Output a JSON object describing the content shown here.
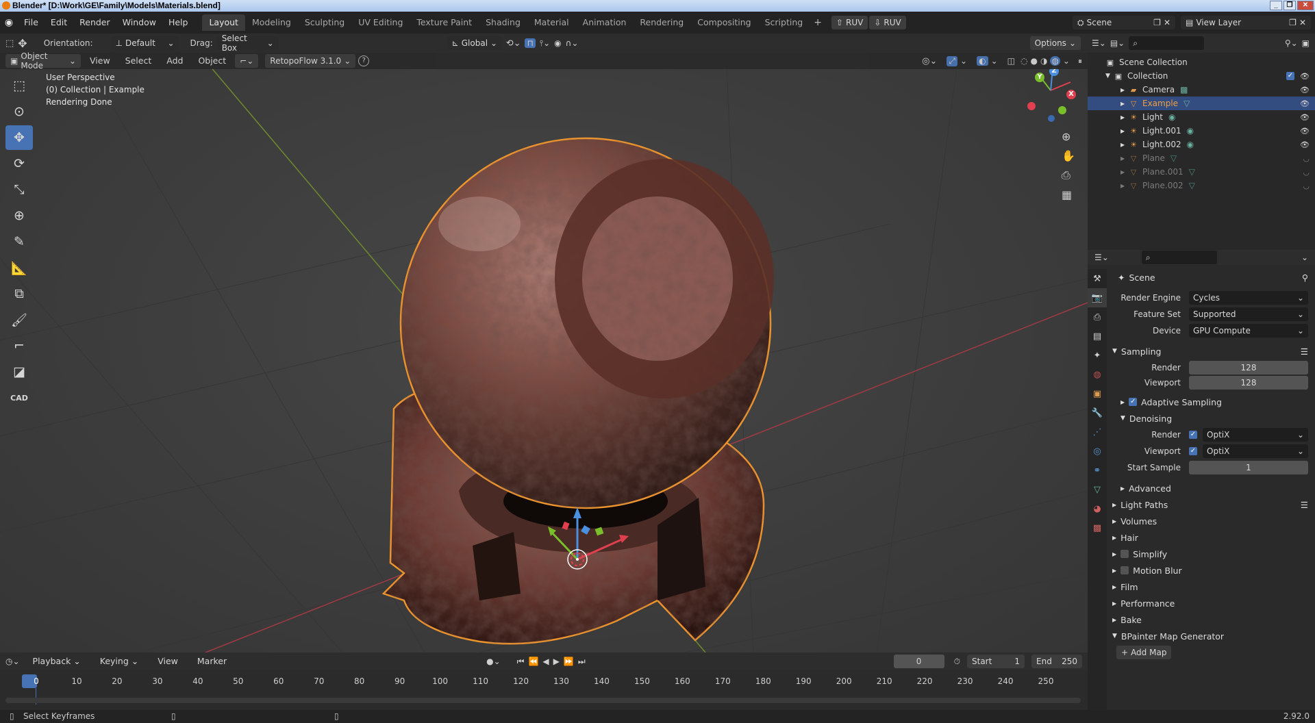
{
  "window": {
    "title": "Blender* [D:\\Work\\GE\\Family\\Models\\Materials.blend]"
  },
  "menu": [
    "File",
    "Edit",
    "Render",
    "Window",
    "Help"
  ],
  "workspaces": [
    "Layout",
    "Modeling",
    "Sculpting",
    "UV Editing",
    "Texture Paint",
    "Shading",
    "Material",
    "Animation",
    "Rendering",
    "Compositing",
    "Scripting"
  ],
  "top_right": {
    "ruv1": "RUV",
    "ruv2": "RUV",
    "scene": "Scene",
    "view_layer": "View Layer"
  },
  "viewport_tools": {
    "orientation_label": "Orientation:",
    "orientation_value": "Default",
    "drag_label": "Drag:",
    "drag_value": "Select Box",
    "transform": "Global",
    "options": "Options"
  },
  "viewport_header": {
    "mode": "Object Mode",
    "view": "View",
    "select": "Select",
    "add": "Add",
    "object": "Object",
    "retopo": "RetopoFlow 3.1.0"
  },
  "overlay": {
    "line1": "User Perspective",
    "line2": "(0) Collection | Example",
    "line3": "Rendering Done"
  },
  "gizmo": {
    "x": "X",
    "y": "Y",
    "z": "Z"
  },
  "toolbar": {
    "cad_label": "CAD"
  },
  "outliner": {
    "root": "Scene Collection",
    "collection": "Collection",
    "items": [
      {
        "name": "Camera",
        "state": "normal"
      },
      {
        "name": "Example",
        "state": "selected"
      },
      {
        "name": "Light",
        "state": "normal"
      },
      {
        "name": "Light.001",
        "state": "normal"
      },
      {
        "name": "Light.002",
        "state": "normal"
      },
      {
        "name": "Plane",
        "state": "hidden"
      },
      {
        "name": "Plane.001",
        "state": "hidden"
      },
      {
        "name": "Plane.002",
        "state": "hidden"
      }
    ]
  },
  "properties": {
    "context": "Scene",
    "render_engine_label": "Render Engine",
    "render_engine": "Cycles",
    "feature_set_label": "Feature Set",
    "feature_set": "Supported",
    "device_label": "Device",
    "device": "GPU Compute",
    "sampling": "Sampling",
    "render_label": "Render",
    "render_samples": "128",
    "viewport_label": "Viewport",
    "viewport_samples": "128",
    "adaptive": "Adaptive Sampling",
    "denoising": "Denoising",
    "den_render_label": "Render",
    "den_render": "OptiX",
    "den_viewport_label": "Viewport",
    "den_viewport": "OptiX",
    "start_sample_label": "Start Sample",
    "start_sample": "1",
    "advanced": "Advanced",
    "panels": [
      "Light Paths",
      "Volumes",
      "Hair",
      "Simplify",
      "Motion Blur",
      "Film",
      "Performance",
      "Bake",
      "BPainter Map Generator"
    ],
    "add_map": "Add Map"
  },
  "timeline": {
    "playback": "Playback",
    "keying": "Keying",
    "view": "View",
    "marker": "Marker",
    "current_frame": "0",
    "start_label": "Start",
    "start": "1",
    "end_label": "End",
    "end": "250",
    "ticks": [
      "0",
      "10",
      "20",
      "30",
      "40",
      "50",
      "60",
      "70",
      "80",
      "90",
      "100",
      "110",
      "120",
      "130",
      "140",
      "150",
      "160",
      "170",
      "180",
      "190",
      "200",
      "210",
      "220",
      "230",
      "240",
      "250"
    ]
  },
  "status": {
    "left": "Select Keyframes",
    "version": "2.92.0"
  }
}
